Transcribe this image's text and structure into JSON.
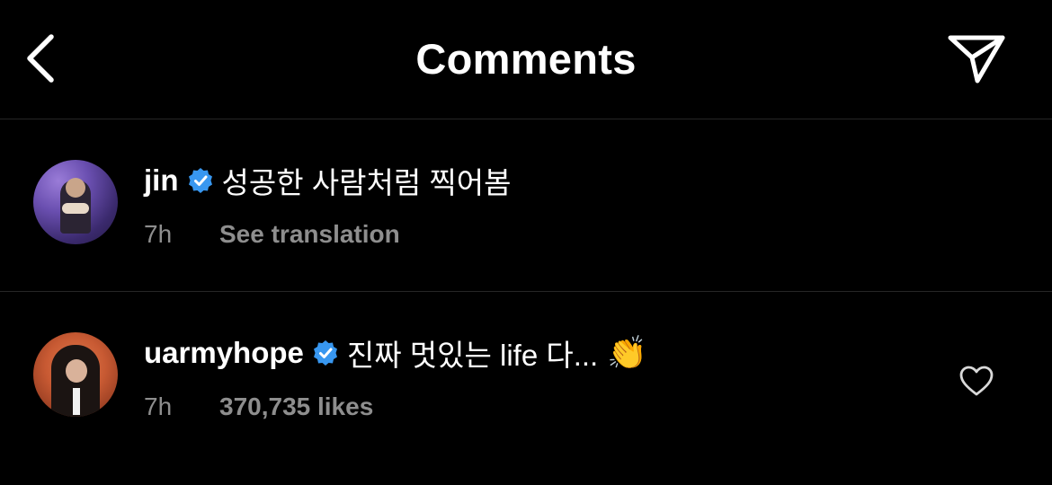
{
  "header": {
    "title": "Comments",
    "back_icon": "chevron-left-icon",
    "share_icon": "paper-plane-icon"
  },
  "comments": [
    {
      "username": "jin",
      "verified": true,
      "text": "성공한 사람처럼 찍어봄",
      "time": "7h",
      "meta": "See translation"
    },
    {
      "username": "uarmyhope",
      "verified": true,
      "text": "진짜 멋있는 life 다...",
      "emoji": "👏",
      "time": "7h",
      "meta": "370,735 likes",
      "like_icon": "heart-outline-icon"
    }
  ],
  "colors": {
    "background": "#000000",
    "secondary_text": "#8e8e8e",
    "verified_blue": "#3897f0",
    "divider": "#262626"
  }
}
